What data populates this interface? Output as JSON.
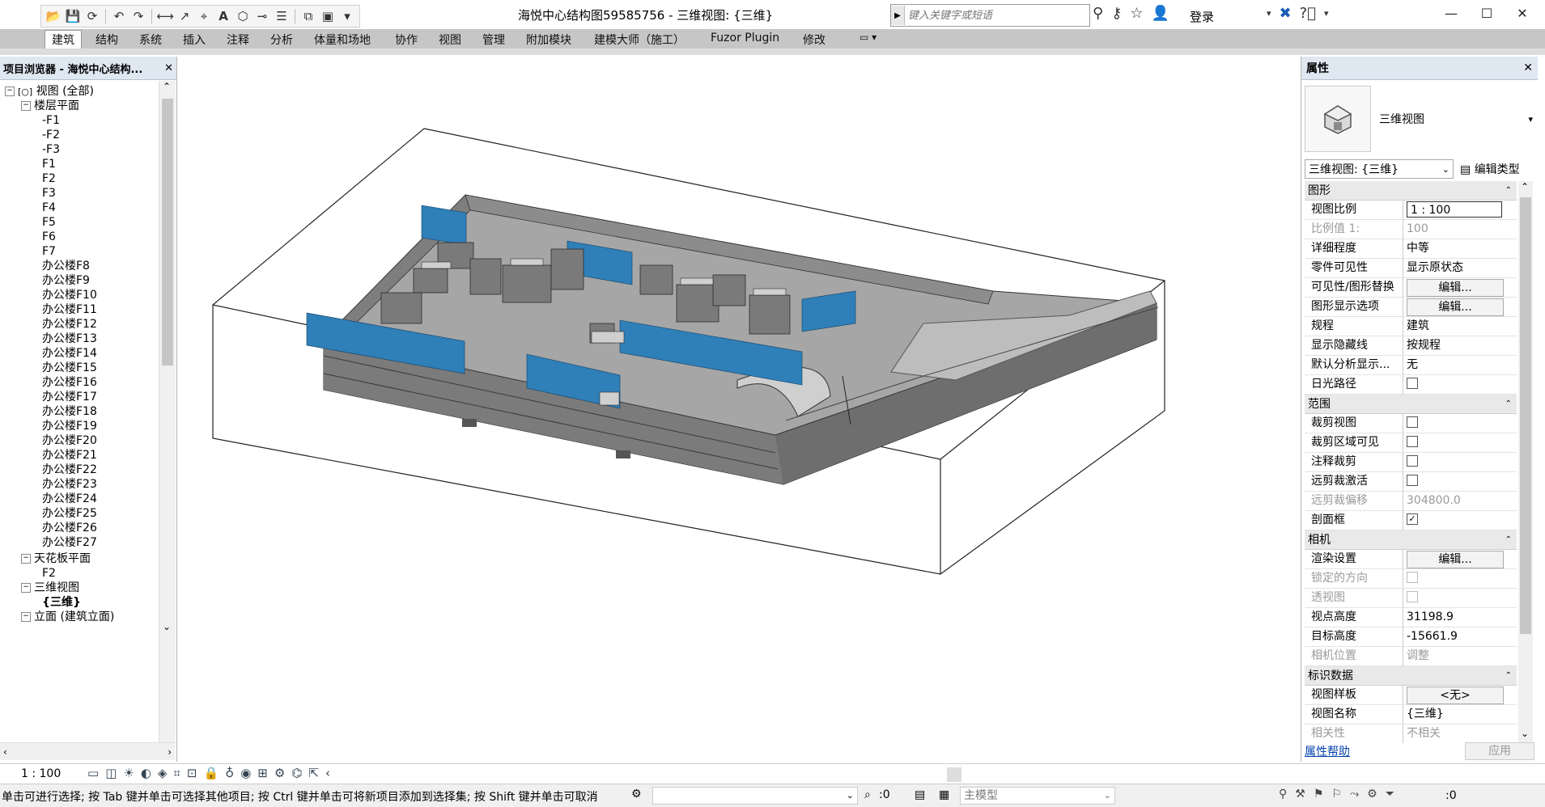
{
  "window": {
    "title": "海悦中心结构图59585756 - 三维视图: {三维}",
    "controls": [
      "minimize-icon",
      "maximize-icon",
      "close-icon"
    ]
  },
  "quick_access": {
    "icons": [
      "open-icon",
      "save-icon",
      "sync-icon",
      "undo-icon",
      "redo-icon",
      "measure-icon",
      "dimension-icon",
      "tag-icon",
      "text-icon",
      "3d-view-icon",
      "section-icon",
      "thin-lines-icon",
      "close-hidden-icon",
      "switch-windows-icon",
      "customize-icon"
    ],
    "text_button": "A"
  },
  "search": {
    "placeholder": "键入关键字或短语"
  },
  "account": {
    "login_label": "登录"
  },
  "menu": {
    "items": [
      "建筑",
      "结构",
      "系统",
      "插入",
      "注释",
      "分析",
      "体量和场地",
      "协作",
      "视图",
      "管理",
      "附加模块",
      "建模大师（施工）",
      "Fuzor Plugin",
      "修改"
    ],
    "active": "建筑"
  },
  "project_browser": {
    "title": "项目浏览器 - 海悦中心结构...",
    "root": "视图 (全部)",
    "floor_plans_label": "楼层平面",
    "floor_plans": [
      "-F1",
      "-F2",
      "-F3",
      "F1",
      "F2",
      "F3",
      "F4",
      "F5",
      "F6",
      "F7",
      "办公楼F8",
      "办公楼F9",
      "办公楼F10",
      "办公楼F11",
      "办公楼F12",
      "办公楼F13",
      "办公楼F14",
      "办公楼F15",
      "办公楼F16",
      "办公楼F17",
      "办公楼F18",
      "办公楼F19",
      "办公楼F20",
      "办公楼F21",
      "办公楼F22",
      "办公楼F23",
      "办公楼F24",
      "办公楼F25",
      "办公楼F26",
      "办公楼F27"
    ],
    "ceiling_plans_label": "天花板平面",
    "ceiling_plans": [
      "F2"
    ],
    "views_3d_label": "三维视图",
    "views_3d": [
      "{三维}"
    ],
    "elevations_label": "立面 (建筑立面)"
  },
  "properties": {
    "title": "属性",
    "type_name": "三维视图",
    "view_selector": "三维视图: {三维}",
    "edit_type_label": "编辑类型",
    "groups": {
      "graphics": "图形",
      "extents": "范围",
      "camera": "相机",
      "identity": "标识数据"
    },
    "rows": {
      "view_scale": {
        "name": "视图比例",
        "value": "1 : 100"
      },
      "scale_value": {
        "name": "比例值 1:",
        "value": "100"
      },
      "detail_level": {
        "name": "详细程度",
        "value": "中等"
      },
      "parts_visibility": {
        "name": "零件可见性",
        "value": "显示原状态"
      },
      "vg_overrides": {
        "name": "可见性/图形替换",
        "value": "编辑..."
      },
      "graphic_display": {
        "name": "图形显示选项",
        "value": "编辑..."
      },
      "discipline": {
        "name": "规程",
        "value": "建筑"
      },
      "show_hidden": {
        "name": "显示隐藏线",
        "value": "按规程"
      },
      "analysis_display": {
        "name": "默认分析显示...",
        "value": "无"
      },
      "sun_path": {
        "name": "日光路径",
        "checked": false
      },
      "crop_view": {
        "name": "裁剪视图",
        "checked": false
      },
      "crop_visible": {
        "name": "裁剪区域可见",
        "checked": false
      },
      "annotation_crop": {
        "name": "注释裁剪",
        "checked": false
      },
      "far_clip_active": {
        "name": "远剪裁激活",
        "checked": false
      },
      "far_clip_offset": {
        "name": "远剪裁偏移",
        "value": "304800.0"
      },
      "section_box": {
        "name": "剖面框",
        "checked": true
      },
      "render_settings": {
        "name": "渲染设置",
        "value": "编辑..."
      },
      "locked_orientation": {
        "name": "锁定的方向",
        "checked": false
      },
      "perspective": {
        "name": "透视图",
        "checked": false
      },
      "eye_elevation": {
        "name": "视点高度",
        "value": "31198.9"
      },
      "target_elevation": {
        "name": "目标高度",
        "value": "-15661.9"
      },
      "camera_position": {
        "name": "相机位置",
        "value": "调整"
      },
      "view_template": {
        "name": "视图样板",
        "value": "<无>"
      },
      "view_name": {
        "name": "视图名称",
        "value": "{三维}"
      },
      "dependency": {
        "name": "相关性",
        "value": "不相关"
      }
    },
    "help_link": "属性帮助",
    "apply_label": "应用"
  },
  "view_control": {
    "scale": "1 : 100"
  },
  "status": {
    "message": "单击可进行选择; 按 Tab 键并单击可选择其他项目; 按 Ctrl 键并单击可将新项目添加到选择集; 按 Shift 键并单击可取消",
    "workset_count": ":0",
    "model_label": "主模型",
    "filter_count": ":0"
  },
  "colors": {
    "panel_header": "#dfe7f1",
    "menu_bar": "#c6c6c6",
    "glass": "#2f7fb8",
    "model_gray": "#8c8c8c"
  }
}
